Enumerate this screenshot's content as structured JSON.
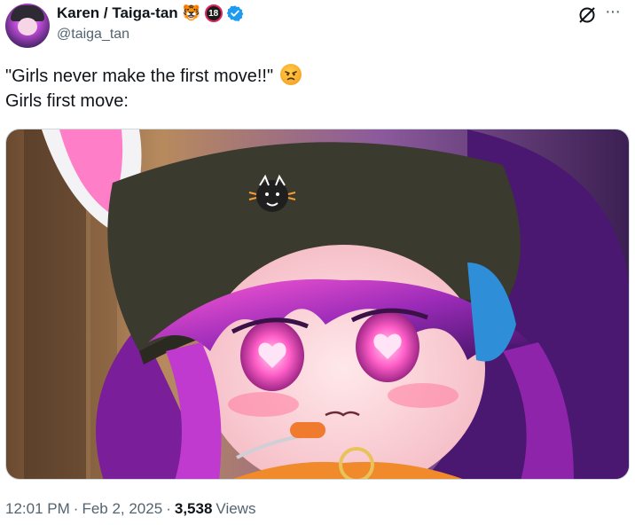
{
  "author": {
    "display_name": "Karen / Taiga-tan",
    "handle": "@taiga_tan",
    "badge_emoji": "🐯",
    "age_badge": "18",
    "verified": true
  },
  "tweet": {
    "line1": "\"Girls never make the first move!!\"",
    "line2": "Girls first move:",
    "emoji": "angry-face"
  },
  "media": {
    "icon": "anime-girl-artwork"
  },
  "meta": {
    "time": "12:01 PM",
    "separator1": "·",
    "date": "Feb 2, 2025",
    "separator2": "·",
    "views_count": "3,538",
    "views_label": "Views"
  },
  "actions": {
    "grok_icon": "grok-icon",
    "more_icon": "more-icon",
    "more_label": "···"
  },
  "colors": {
    "text_primary": "#0f1419",
    "text_secondary": "#536471",
    "verified_blue": "#1d9bf0",
    "border": "#cfd9de"
  }
}
